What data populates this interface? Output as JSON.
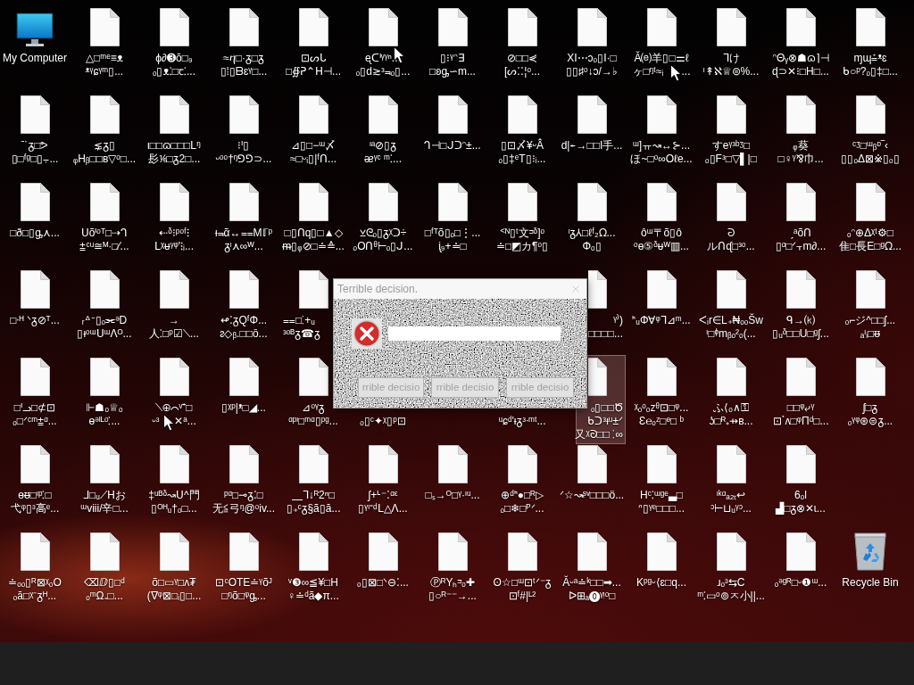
{
  "desktop": {
    "rows": [
      [
        {
          "kind": "computer",
          "lines": [
            "My Computer"
          ],
          "selected": false
        },
        {
          "kind": "file",
          "lines": [
            "△□ᵐᵉ≡ᴥ",
            "ᵜᵞɕᵞᵐ▯..."
          ],
          "selected": false
        },
        {
          "kind": "file",
          "lines": [
            "ϕ∂➌ŏ□₉",
            "ₒ▯ᴥ⁚□ꞇ⁚..."
          ],
          "selected": false
        },
        {
          "kind": "file",
          "lines": [
            "≈ⴄ□·ᵹ□ᵹ",
            "▯⁞▯ᗷɛᵞ□..."
          ],
          "selected": false
        },
        {
          "kind": "file",
          "lines": [
            "⊡ᔕᒐ",
            "□∯ᕈ⌃ᕼ⊣..."
          ],
          "selected": false
        },
        {
          "kind": "file",
          "lines": [
            "ᶒᑕᑊᵞᵞⁿ...",
            "ₒ▯d≳ᵌ⫬ₒ▯..."
          ],
          "selected": false
        },
        {
          "kind": "file",
          "lines": [
            "▯⁝ᵞᵔ∃",
            "□ʚᶃ∽m..."
          ],
          "selected": false
        },
        {
          "kind": "file",
          "lines": [
            "⊘□□⋞",
            "[ᔕ⁚⁚¦ᵒ..."
          ],
          "selected": false
        },
        {
          "kind": "file",
          "lines": [
            "XI⋯ɔₒ▯I·□",
            "▯▯♯ᵒ↓ɔ/→♭"
          ],
          "selected": false
        },
        {
          "kind": "file",
          "lines": [
            "Ă⒠羊▯□⚌ℓ",
            "ヶ□ᵑᵗ≈ᵢ      ..."
          ],
          "selected": false
        },
        {
          "kind": "file",
          "lines": [
            "ᒣけ",
            "ᶥ↟ℵ♕⊜%..."
          ],
          "selected": false
        },
        {
          "kind": "file",
          "lines": [
            "ᵔΘᵧ⊗☗ɷ⌉⊣",
            "ɖ⊃✕⁝□H□..."
          ],
          "selected": false
        },
        {
          "kind": "file",
          "lines": [
            "ɱɰ⩮ᵜɛ",
            "ᑲ○ᵖ?ₒ▯‡□..."
          ],
          "selected": false
        }
      ],
      [
        {
          "kind": "file",
          "lines": [
            "ˉ˙ᵹ□ᕗ",
            "▯□ᶠᵍ□▯⨪..."
          ],
          "selected": false
        },
        {
          "kind": "file",
          "lines": [
            "⋦ᵹ▯",
            "ᵩHᵦ□□ʙ▽ᵒ□..."
          ],
          "selected": false
        },
        {
          "kind": "file",
          "lines": [
            "ι□□ɷ□□□ᒪᵑ",
            "髟⅙□ᵹ2□..."
          ],
          "selected": false
        },
        {
          "kind": "file",
          "lines": [
            "⁝ᑊ▯",
            "ᵕᵒᵒ†ᵑ⅁⅁⊃..."
          ],
          "selected": false
        },
        {
          "kind": "file",
          "lines": [
            "⊿▯□−ᵚ〆",
            "≈□ᵕᵢ▯|ᶠᑎ..."
          ],
          "selected": false
        },
        {
          "kind": "file",
          "lines": [
            "ᶥᵃ⊘▯ᵹ",
            "ᴂᵞᶜ ᵐ⁚..."
          ],
          "selected": false
        },
        {
          "kind": "file",
          "lines": [
            "ᒉ⊣□ᒍᑐᵔ±..."
          ],
          "selected": false
        },
        {
          "kind": "file",
          "lines": [
            "▯⊡〆¥ᵕÂ",
            "ₒ▯‡ᵉT▯⁝ᵢ..."
          ],
          "selected": false
        },
        {
          "kind": "file",
          "lines": [
            "d|⍅→□□I手..."
          ],
          "selected": false
        },
        {
          "kind": "file",
          "lines": [
            "ᵚ]ㅠ↝↔⊱...",
            "ほ~□ᵒ∞Oℓe..."
          ],
          "selected": false
        },
        {
          "kind": "file",
          "lines": [
            "すeᵞᵌᵇᶾ□",
            "ₒ▯Fᵌ□▽▌|□"
          ],
          "selected": false
        },
        {
          "kind": "file",
          "lines": [
            "ᵩ葵",
            "□♀ᵞ⅋巾..."
          ],
          "selected": false
        },
        {
          "kind": "file",
          "lines": [
            "ᶜᶾ□ᵚᵦᶛ‾‹",
            "▯▯ₒΔ⊠※▯ₒ▯"
          ],
          "selected": false
        }
      ],
      [
        {
          "kind": "file",
          "lines": [
            "□ð□▯ᶃ⋏..."
          ],
          "selected": false
        },
        {
          "kind": "file",
          "lines": [
            "ᑌõᑊᵒᵀ□⇢ᒉ",
            "⩲ᶜᵘ≅ᴹ·□⁄..."
          ],
          "selected": false
        },
        {
          "kind": "file",
          "lines": [
            "⇠ᵟ⁝ᵖᵒᶠ⁝",
            "ᒪᵡᵾᵞᵠ'⁝ᵢ..."
          ],
          "selected": false
        },
        {
          "kind": "file",
          "lines": [
            "ᵻ⫬ᾶ↔⩵Mℾᵖ",
            "ᵹᶥ⋏∞ᵂ..."
          ],
          "selected": false
        },
        {
          "kind": "file",
          "lines": [
            "□▯ᑎq▯□▲◇",
            "ᵯ▯ᵩ⊘□≐≙..."
          ],
          "selected": false
        },
        {
          "kind": "file",
          "lines": [
            "⊻ᘓₒ▯ᵹᵡᑐ÷",
            "ₒOᑎᶿ⊢ₒ▯ᒍ..."
          ],
          "selected": false
        },
        {
          "kind": "file",
          "lines": [
            "□ᶠᵀõ▯ₒ□⋮...",
            "ᶖ₉+≐□"
          ],
          "selected": false
        },
        {
          "kind": "file",
          "lines": [
            "ᑉᴺ▯ᵗ文ᵙᵟ]ᵒ",
            "≐□◩カ¶ᵒ▯"
          ],
          "selected": false
        },
        {
          "kind": "file",
          "lines": [
            "ᶥᵹ⅄□ℓᶠ₂ᘯ...",
            "Φₒ▯"
          ],
          "selected": false
        },
        {
          "kind": "file",
          "lines": [
            "ôᵚ〒õ▯ô",
            "ᵒɵ⑤ᵟᵾᵂ▥..."
          ],
          "selected": false
        },
        {
          "kind": "file",
          "lines": [
            "ᘒ",
            "ルᑎᶑ□ᵌᵒ..."
          ],
          "selected": false
        },
        {
          "kind": "file",
          "lines": [
            "ˏᵃõᑎ",
            "▯ᵅ□ᐟ⫟m∂..."
          ],
          "selected": false
        },
        {
          "kind": "file",
          "lines": [
            "ₒᵔ⊕ᐃᵡᵗ⚙□",
            "隹□長E□ᵍᘯ..."
          ],
          "selected": false
        }
      ],
      [
        {
          "kind": "file",
          "lines": [
            "□ᐧᴴ ᐠᵹ⊘ᵀ..."
          ],
          "selected": false
        },
        {
          "kind": "file",
          "lines": [
            "ᵣᐞᐨ▯ₒ⫘ᵊD",
            "▯ᵻᵒᵚᑌᵚΛᴼ..."
          ],
          "selected": false
        },
        {
          "kind": "file",
          "lines": [
            "→",
            "人⁚□ᵖ☑⟍..."
          ],
          "selected": false
        },
        {
          "kind": "file",
          "lines": [
            "↫⁚ᵹQᶠΦ...",
            "ᴤ◇ᵦ.□□ō..."
          ],
          "selected": false
        },
        {
          "kind": "file",
          "lines": [
            "⩵□⁚+ᵤ",
            "ᵌᵒᴮᵹ☎ᵹ"
          ],
          "selected": false,
          "cut_right": true
        },
        {
          "kind": "covered"
        },
        {
          "kind": "covered"
        },
        {
          "kind": "covered"
        },
        {
          "kind": "file",
          "lines": [
            "ᵞ⁾)",
            "□□□□..."
          ],
          "selected": false,
          "cut_left": true
        },
        {
          "kind": "file",
          "lines": [
            "ᑋᵤΦ∀ᵠᒣ⊿ᵐ..."
          ],
          "selected": false
        },
        {
          "kind": "file",
          "lines": [
            "ᐸᵢr∈L₊₦ₒₒŠw",
            "ᶥ□ᶲmᵦₒ²ₒ(..."
          ],
          "selected": false
        },
        {
          "kind": "file",
          "lines": [
            "ᑫ→⒦",
            "▯ᵤᵟ□□U□ᵍʃ..."
          ],
          "selected": false
        },
        {
          "kind": "file",
          "lines": [
            "ₒ⌐ジ^□□ʃ...",
            "ₐᶥᵢ□ᵿ"
          ],
          "selected": false
        }
      ],
      [
        {
          "kind": "file",
          "lines": [
            "□ᑊᓗ□⊄⊡",
            "ₒ□ᐟᶜᵐ⩲ᵅ..."
          ],
          "selected": false
        },
        {
          "kind": "file",
          "lines": [
            "⊩☗ₒ♕ₒ",
            "ɵᵊᴵᴸᵒ⁚..."
          ],
          "selected": false
        },
        {
          "kind": "file",
          "lines": [
            "⟍⊕⌒ᵛ⁺□",
            "ᵕᶟ     ✕ᵃ..."
          ],
          "selected": false
        },
        {
          "kind": "file",
          "lines": [
            "▯ᵡᵖ|ᵜ□◢..."
          ],
          "selected": false
        },
        {
          "kind": "file",
          "lines": [
            "⊿ᵒᵞᵹ",
            "ᵅᵖᶥ□ᵐᵅ▯ᵖᵍ..."
          ],
          "selected": false
        },
        {
          "kind": "covered",
          "lines": [
            "ₒ▯ᶜ✦ᵡ▯ᵖ⊡"
          ]
        },
        {
          "kind": "covered"
        },
        {
          "kind": "covered",
          "lines": [
            "ᵘɕᵈ'ᵻᵹᵌᐧᵐᵗ..."
          ]
        },
        {
          "kind": "file",
          "lines": [
            "ₒ▯□□Ծ",
            "ᑲᑐᵌᵻᵘ±ᐟ",
            "又ᵡᘐ□□ ⁚∞"
          ],
          "selected": true,
          "cut_left": true
        },
        {
          "kind": "file",
          "lines": [
            "ᵡₒᵒₒzᶿ⊡□ᵠ...",
            "Ɛ℮ₒᶻ□ᶱ□ ᵇ"
          ],
          "selected": false
        },
        {
          "kind": "file",
          "lines": [
            "ふ⟨ₒ∧⚿",
            "ʖ□ᴿ₊⇸ʙ..."
          ],
          "selected": false
        },
        {
          "kind": "file",
          "lines": [
            "□□ᵠ⤶ᵞ",
            "⊡ˋᴧ□ᵠΠᵈ□..."
          ],
          "selected": false
        },
        {
          "kind": "file",
          "lines": [
            "ʃ□ᵹ",
            "ₒᵞᵠ⊛⊜ᵹ..."
          ],
          "selected": false
        }
      ],
      [
        {
          "kind": "file",
          "lines": [
            "ɵᵿ□ᶥᵖ⁚□",
            "弋ᵠ▯ᶟ高ᵉ..."
          ],
          "selected": false
        },
        {
          "kind": "file",
          "lines": [
            "ᒧ□ᵤ⟋ᕼお",
            "ᵚviii/辛□..."
          ],
          "selected": false
        },
        {
          "kind": "file",
          "lines": [
            "‡ᵘᴮᵟ↝ᑌ^門",
            "▯ᴼᴴᵤ†ₒ□..."
          ],
          "selected": false
        },
        {
          "kind": "file",
          "lines": [
            "ᵖᵅ□⊸ᵹ⁚□",
            "无≦弓ᵑ@ᵒiv..."
          ],
          "selected": false
        },
        {
          "kind": "file",
          "lines": [
            "⎽ᒣ↓ᴿ2ⁿ□",
            "▯₊ᶜᵹ§ã▯ă..."
          ],
          "selected": false
        },
        {
          "kind": "file",
          "lines": [
            "ʃ+ᒻ⁻⁚ᵅᵋ",
            "▯ᵞᶦ⁼ᵈᒪ△Λ..."
          ],
          "selected": false
        },
        {
          "kind": "file",
          "lines": [
            "□ₛ→ᴼ□ᵞ·ᶥᵘ..."
          ],
          "selected": false
        },
        {
          "kind": "file",
          "lines": [
            "⊕ᵈᑋ●□ᴿ▷",
            "ₒ□❄□ᴾᐟ..."
          ],
          "selected": false
        },
        {
          "kind": "file",
          "lines": [
            "ᐟ☆↝ᶳᵛ□□□ö..."
          ],
          "selected": false
        },
        {
          "kind": "file",
          "lines": [
            "Hᶜ⁚ᵚᵍᵉ▃□",
            "ᐢ▯ᵞᵉ□□□..."
          ],
          "selected": false
        },
        {
          "kind": "file",
          "lines": [
            "ᶦᵏᵅₐ₂ₜ↩",
            "ᵓ⊢⊔ᵤᵞᵓ..."
          ],
          "selected": false
        },
        {
          "kind": "file",
          "lines": [
            "6ₒl",
            "▟□ᵹ⊗✕ɩ..."
          ],
          "selected": false
        },
        {
          "kind": "empty"
        }
      ],
      [
        {
          "kind": "file",
          "lines": [
            "≐ₒₒ▯ᴿ⊠ᵡₒO",
            "ₒă□ᵡ⁻ᵹᴴ..."
          ],
          "selected": false
        },
        {
          "kind": "file",
          "lines": [
            "⌫ⅅ▯□ᵈ",
            "ₒᵐΩ₌□..."
          ],
          "selected": false
        },
        {
          "kind": "file",
          "lines": [
            "õ□▭ᵞ□ᴧ₮",
            "(ᐁᵠ⊠□ᵢ▯□..."
          ],
          "selected": false
        },
        {
          "kind": "file",
          "lines": [
            "⊡ᶜOTE≐ᵞõᴶ",
            "□ᵑõ□ᵠᶃ..."
          ],
          "selected": false
        },
        {
          "kind": "file",
          "lines": [
            "ᵛ❸∞≦¥□H",
            "♀≐ᵈã◆π..."
          ],
          "selected": false
        },
        {
          "kind": "file",
          "lines": [
            "ₒ▯⊠□ᐠ⊖⁚..."
          ],
          "selected": false
        },
        {
          "kind": "file",
          "lines": [
            "ⓅᴿYₕᵙₒ✚",
            "▯○ᴿ⁻⁻→..."
          ],
          "selected": false
        },
        {
          "kind": "file",
          "lines": [
            "ʘ☆□ᵚ⊡ᵗᐟ⁻ᵹ",
            "⊡ᶠ#|ᴸ²"
          ],
          "selected": false
        },
        {
          "kind": "file",
          "lines": [
            "Ăᵕᵃ≐ᵏ□□➡...",
            "ᐅ⊞ₐ⓿ᵞᵎᵒ□"
          ],
          "selected": false
        },
        {
          "kind": "file",
          "lines": [
            "Kᵖᵍᵕ⟨ɛ□q..."
          ],
          "selected": false
        },
        {
          "kind": "file",
          "lines": [
            "ɹₒᶟ⇆C",
            "ᵐ⁚▭ᵒ⊚ㅈ小||..."
          ],
          "selected": false
        },
        {
          "kind": "file",
          "lines": [
            "ₒᵊᵍᴿ□ᵕ❶ᵚ..."
          ],
          "selected": false
        },
        {
          "kind": "recycle",
          "lines": [
            "Recycle Bin"
          ],
          "selected": false
        }
      ]
    ]
  },
  "dialog": {
    "title": "Terrible decision.",
    "buttons": [
      "rrible decisio",
      "rrible decisio",
      "rrible decisio"
    ]
  }
}
